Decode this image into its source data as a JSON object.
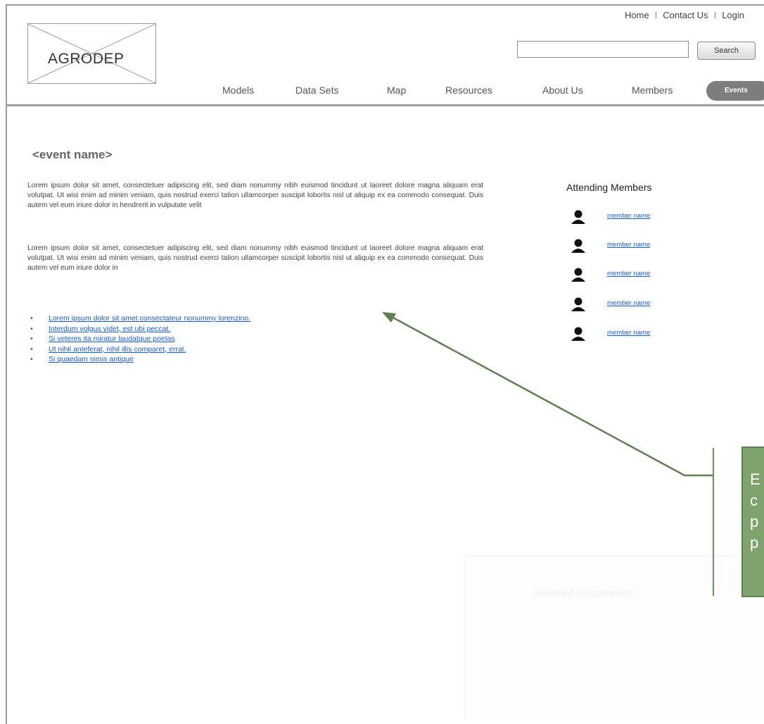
{
  "header": {
    "logo_text": "AGRODEP",
    "top_links": [
      "Home",
      "Contact Us",
      "Login"
    ],
    "search_button": "Search",
    "search_value": "",
    "nav": [
      "Models",
      "Data Sets",
      "Map",
      "Resources",
      "About Us",
      "Members"
    ],
    "nav_active": "Events"
  },
  "main": {
    "event_title": "<event name>",
    "paragraph_1": "Lorem ipsum dolor sit amet, consectetuer adipiscing elit, sed diam nonummy nibh euismod tincidunt ut laoreet dolore magna aliquam erat volutpat. Ut wisi enim ad minim veniam, quis nostrud exerci tation ullamcorper suscipit lobortis nisl ut aliquip ex ea commodo consequat. Duis autem vel eum iriure dolor in hendrerit in vulputate velit",
    "paragraph_2": "Lorem ipsum dolor sit amet, consectetuer adipiscing elit, sed diam nonummy nibh euismod tincidunt ut laoreet dolore magna aliquam erat volutpat. Ut wisi enim ad minim veniam, quis nostrud exerci tation ullamcorper suscipit lobortis nisl ut aliquip ex ea commodo consequat. Duis autem vel eum iriure dolor in",
    "links": [
      "Lorem ipsum dolor sit amet consectateur nonummy lorenzino.",
      "Interdum volgus videt, est ubi peccat.",
      "Si veteres ita miratur laudatque poetas",
      "Ut nihil anteferat, nihil illis comparet, errat.",
      "Si quaedam nimis antique"
    ],
    "bullet": "•"
  },
  "sidebar": {
    "heading": "Attending Members",
    "members": [
      "member name",
      "member name",
      "member name",
      "member name",
      "member name"
    ]
  },
  "annotation": {
    "callout_text_lines": [
      "E",
      "c",
      "p",
      "p"
    ],
    "faint_text": "Related Documents"
  },
  "colors": {
    "link": "#1a5bd6",
    "callout_green": "#7ea36c",
    "events_pill": "#7d7d7d"
  }
}
